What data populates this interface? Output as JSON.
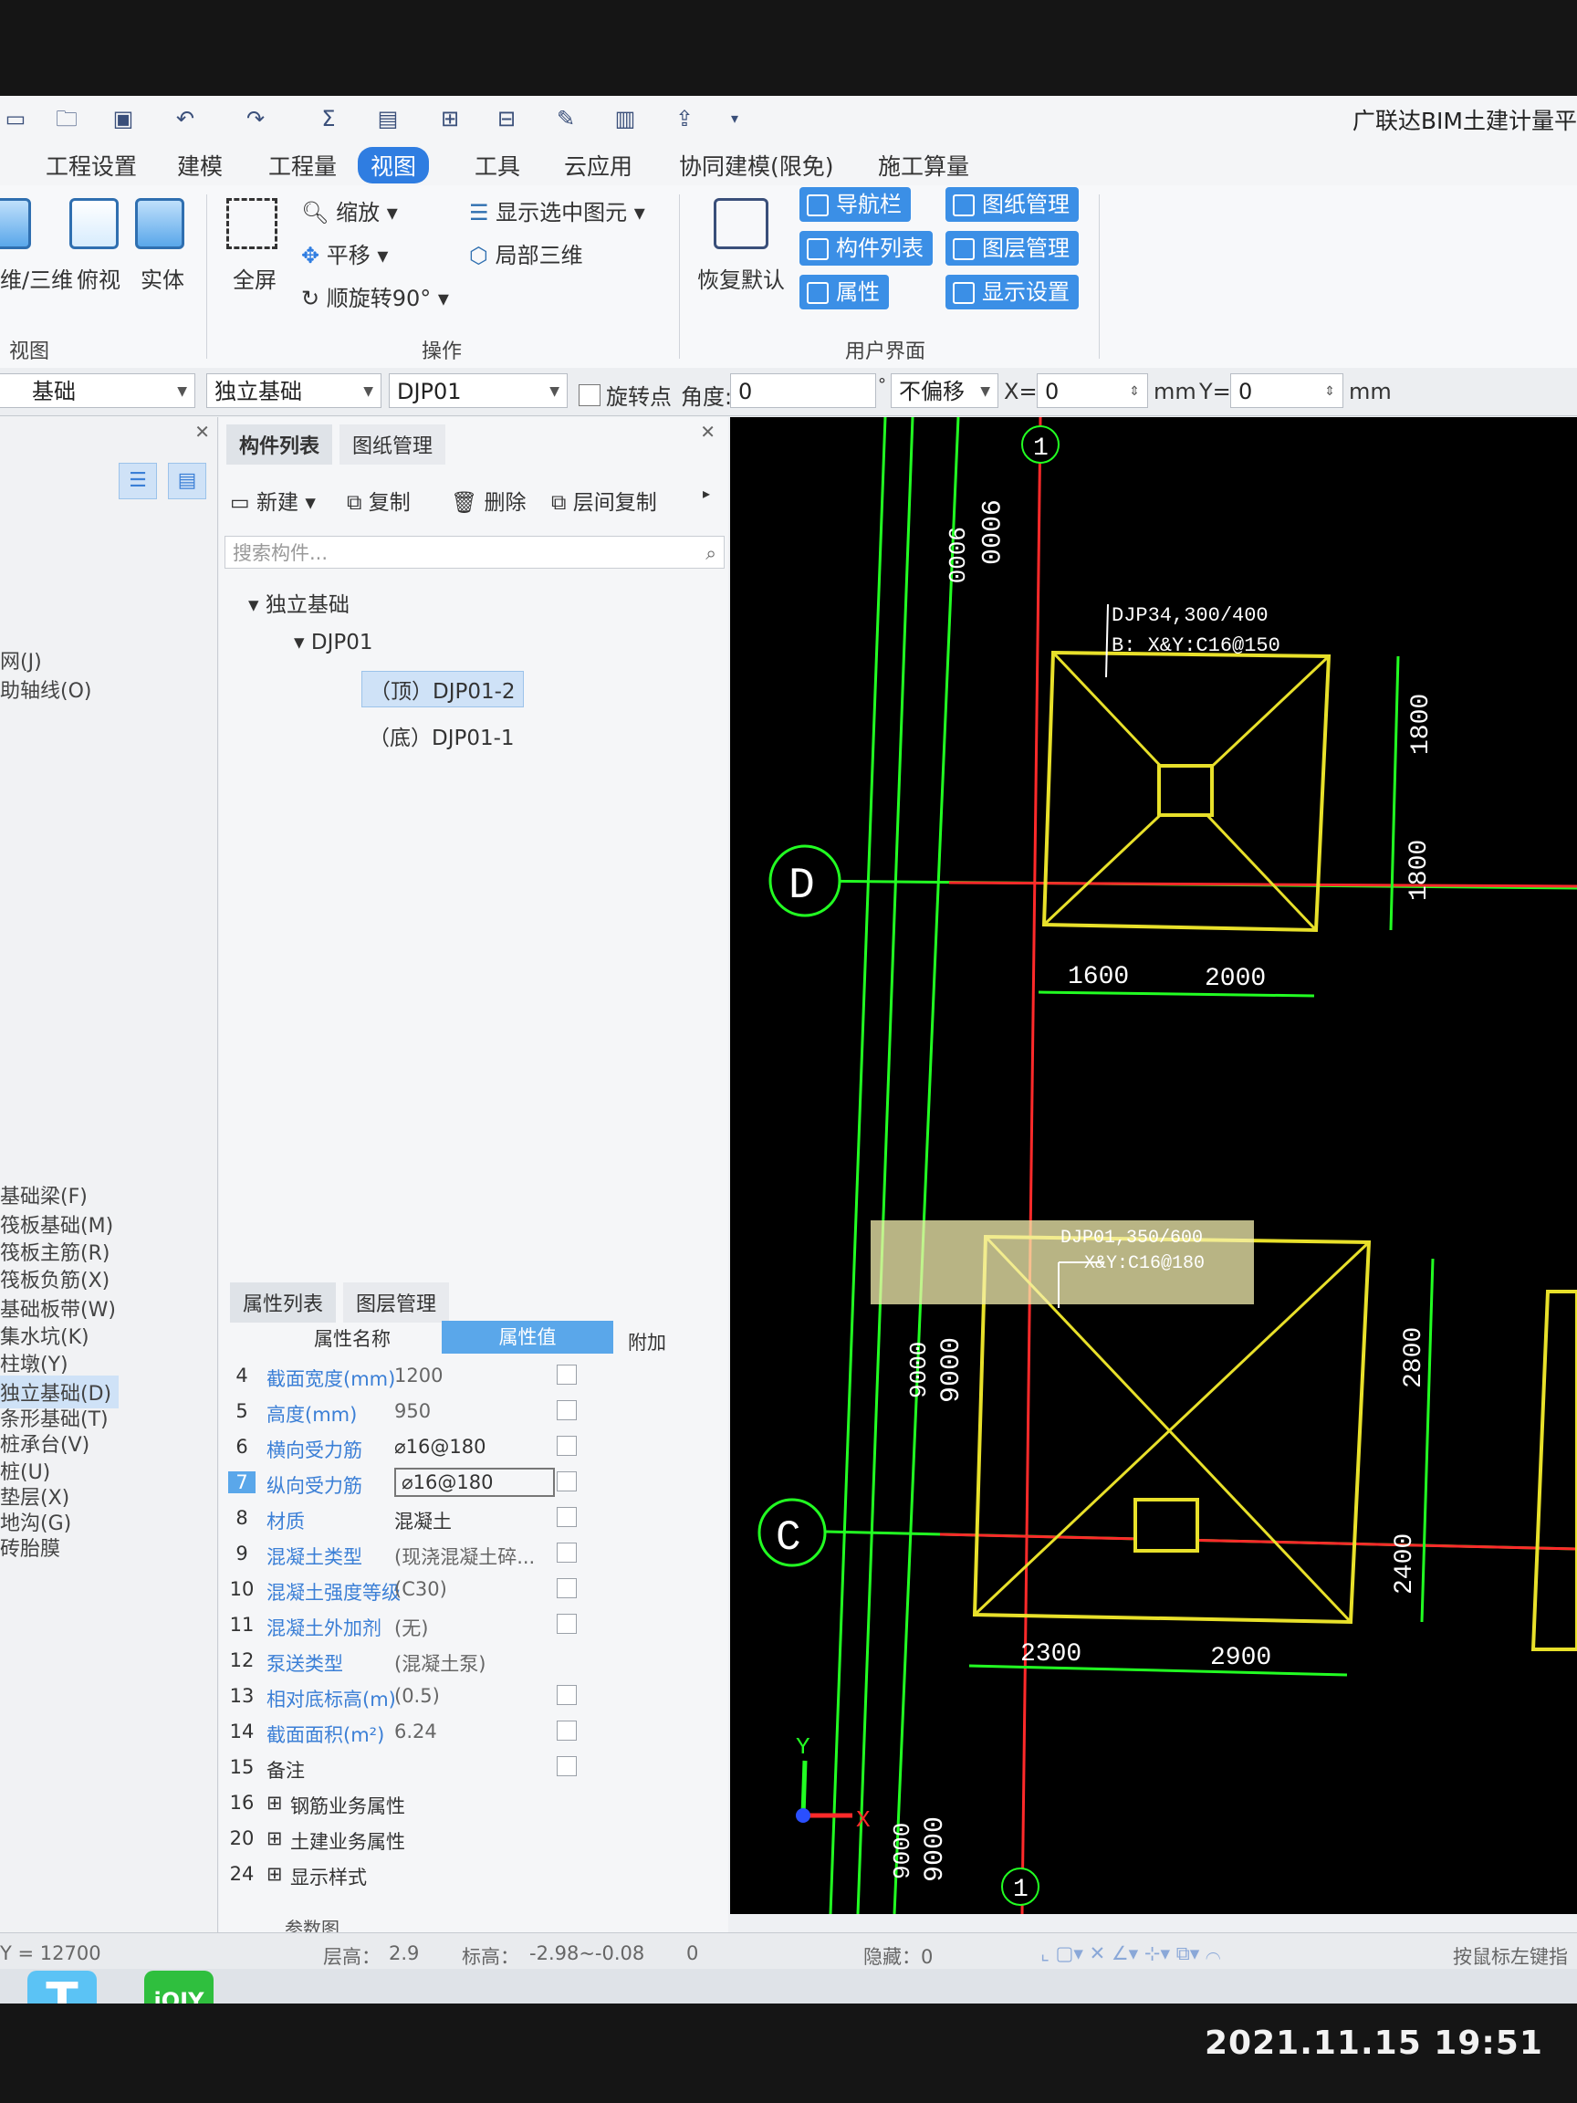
{
  "app_title": "广联达BIM土建计量平",
  "ribbon_tabs": [
    "工程设置",
    "建模",
    "工程量",
    "视图",
    "工具",
    "云应用",
    "协同建模(限免)",
    "施工算量"
  ],
  "active_tab": "视图",
  "view_group": {
    "btn_2d3d": "维/三维",
    "btn_top": "俯视",
    "btn_solid": "实体",
    "label": "视图"
  },
  "ops_group": {
    "fullscreen": "全屏",
    "zoom": "缩放",
    "pan": "平移",
    "rotate": "顺旋转90°",
    "show_selected": "显示选中图元",
    "partial_3d": "局部三维",
    "label": "操作"
  },
  "ui_group": {
    "restore": "恢复默认",
    "nav": "导航栏",
    "drawing_mgmt": "图纸管理",
    "component_list": "构件列表",
    "layer_mgmt": "图层管理",
    "props": "属性",
    "display_settings": "显示设置",
    "label": "用户界面"
  },
  "filter_bar": {
    "category": "基础",
    "type": "独立基础",
    "component": "DJP01",
    "rotate_point": "旋转点",
    "angle_label": "角度:",
    "angle_value": "0",
    "degree": "°",
    "offset": "不偏移",
    "x_label": "X=",
    "x_value": "0",
    "mm1": "mm",
    "y_label": "Y=",
    "y_value": "0",
    "mm2": "mm"
  },
  "left_nav": [
    "网(J)",
    "助轴线(O)",
    "基础梁(F)",
    "筏板基础(M)",
    "筏板主筋(R)",
    "筏板负筋(X)",
    "基础板带(W)",
    "集水坑(K)",
    "柱墩(Y)",
    "独立基础(D)",
    "条形基础(T)",
    "桩承台(V)",
    "桩(U)",
    "垫层(X)",
    "地沟(G)",
    "砖胎膜"
  ],
  "left_nav_selected": "独立基础(D)",
  "comp_panel": {
    "tab1": "构件列表",
    "tab2": "图纸管理",
    "new": "新建",
    "copy": "复制",
    "delete": "删除",
    "layer_copy": "层间复制",
    "search_placeholder": "搜索构件...",
    "root": "独立基础",
    "child": "DJP01",
    "leaf1": "（顶）DJP01-2",
    "leaf2": "（底）DJP01-1"
  },
  "prop_panel": {
    "tab1": "属性列表",
    "tab2": "图层管理",
    "col_name": "属性名称",
    "col_value": "属性值",
    "col_extra": "附加",
    "rows": [
      {
        "no": "4",
        "name": "截面宽度(mm)",
        "value": "1200"
      },
      {
        "no": "5",
        "name": "高度(mm)",
        "value": "950"
      },
      {
        "no": "6",
        "name": "横向受力筋",
        "value": "⌀16@180"
      },
      {
        "no": "7",
        "name": "纵向受力筋",
        "value": "⌀16@180"
      },
      {
        "no": "8",
        "name": "材质",
        "value": "混凝土"
      },
      {
        "no": "9",
        "name": "混凝土类型",
        "value": "(现浇混凝土碎..."
      },
      {
        "no": "10",
        "name": "混凝土强度等级",
        "value": "(C30)"
      },
      {
        "no": "11",
        "name": "混凝土外加剂",
        "value": "(无)"
      },
      {
        "no": "12",
        "name": "泵送类型",
        "value": "(混凝土泵)"
      },
      {
        "no": "13",
        "name": "相对底标高(m)",
        "value": "(0.5)"
      },
      {
        "no": "14",
        "name": "截面面积(m²)",
        "value": "6.24"
      },
      {
        "no": "15",
        "name": "备注",
        "value": ""
      },
      {
        "no": "16",
        "name": "钢筋业务属性",
        "value": ""
      },
      {
        "no": "20",
        "name": "土建业务属性",
        "value": ""
      },
      {
        "no": "24",
        "name": "显示样式",
        "value": ""
      }
    ],
    "param_fig": "参数图"
  },
  "canvas": {
    "dim_9000": "9000",
    "axis_top": "1",
    "axis_bottom": "1",
    "axis_d": "D",
    "axis_c": "C",
    "label1a": "DJP34,300/400",
    "label1b": "B: X&Y:C16@150",
    "label2a": "DJP01,350/600",
    "label2b": "X&Y:C16@180",
    "dims": {
      "d1800a": "1800",
      "d1800b": "1800",
      "d1600": "1600",
      "d2000": "2000",
      "d2800": "2800",
      "d2400": "2400",
      "d2300": "2300",
      "d2900": "2900"
    },
    "ucs_x": "X",
    "ucs_y": "Y"
  },
  "status": {
    "coord": "Y = 12700",
    "floor_height": "层高：",
    "floor_height_value": "2.9",
    "elevation": "标高：",
    "elevation_value": "-2.98~-0.08",
    "count": "0",
    "hidden": "隐藏：0",
    "hint": "按鼠标左键指"
  },
  "timestamp": "2021.11.15 19:51"
}
